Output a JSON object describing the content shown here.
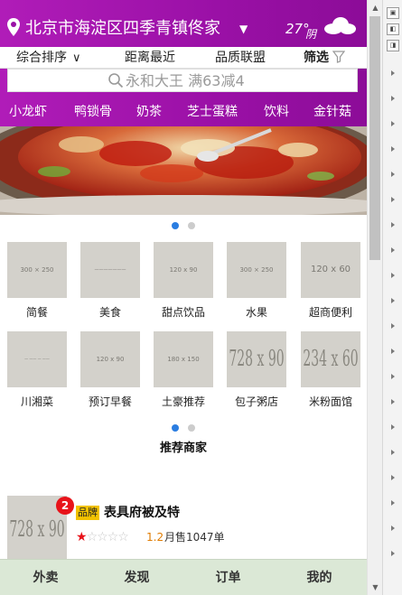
{
  "header": {
    "location": "北京市海淀区四季青镇佟家",
    "location_caret": "▼",
    "weather_temp": "27°",
    "weather_desc": "阴"
  },
  "sortbar": {
    "items": [
      "综合排序",
      "距离最近",
      "品质联盟",
      "筛选"
    ],
    "sort_chevron": "∨"
  },
  "search": {
    "placeholder": "永和大王 满63减4"
  },
  "categories": [
    "小龙虾",
    "鸭锁骨",
    "奶茶",
    "芝士蛋糕",
    "饮料",
    "金针菇"
  ],
  "grid": {
    "row1": [
      {
        "label": "简餐",
        "img": "300 × 250"
      },
      {
        "label": "美食",
        "img": "———————"
      },
      {
        "label": "甜点饮品",
        "img": "120 x 90"
      },
      {
        "label": "水果",
        "img": "300 × 250"
      },
      {
        "label": "超商便利",
        "img": "120 x 60"
      }
    ],
    "row2": [
      {
        "label": "川湘菜",
        "img": "—  ——  — ——"
      },
      {
        "label": "预订早餐",
        "img": "120 x 90"
      },
      {
        "label": "土豪推荐",
        "img": "180 x 150"
      },
      {
        "label": "包子粥店",
        "img": "728 x 90"
      },
      {
        "label": "米粉面馆",
        "img": "234 x 60"
      }
    ]
  },
  "section_title": "推荐商家",
  "merchant": {
    "badge_count": "2",
    "brand_tag": "品牌",
    "name": "表具府被及特",
    "thumb_img": "728 x 90",
    "rating": 1.2,
    "rating_text": "1.2",
    "max_rating": 5,
    "sales": "月售1047单"
  },
  "tabbar": [
    "外卖",
    "发现",
    "订单",
    "我的"
  ],
  "colors": {
    "header_purple": "#9a10a6",
    "active_dot": "#2a7de1",
    "badge_red": "#e8131a",
    "brand_yellow": "#f2c200",
    "tabbar_bg": "#dbe8d6"
  },
  "carousel": {
    "banner_active_index": 0,
    "grid_active_index": 0,
    "count": 2
  }
}
